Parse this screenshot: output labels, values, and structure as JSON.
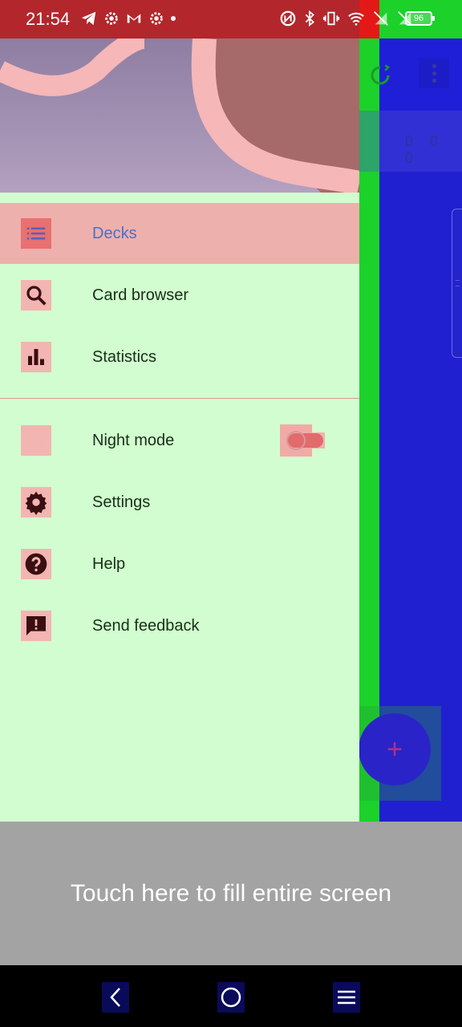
{
  "status_bar": {
    "time": "21:54",
    "battery_level": "96",
    "left_icons": [
      "telegram-icon",
      "settings-icon",
      "gmail-icon",
      "settings-icon",
      "dot-icon"
    ],
    "right_icons": [
      "nfc-icon",
      "bluetooth-icon",
      "vibrate-icon",
      "wifi-icon",
      "no-sim-icon",
      "no-sim-icon"
    ]
  },
  "drawer": {
    "items": [
      {
        "label": "Decks",
        "icon": "list-icon",
        "active": true
      },
      {
        "label": "Card browser",
        "icon": "search-icon",
        "active": false
      },
      {
        "label": "Statistics",
        "icon": "bar-chart-icon",
        "active": false
      },
      {
        "label": "Night mode",
        "icon": "moon-icon",
        "toggle": false
      },
      {
        "label": "Settings",
        "icon": "gear-icon"
      },
      {
        "label": "Help",
        "icon": "help-icon"
      },
      {
        "label": "Send feedback",
        "icon": "feedback-icon"
      }
    ]
  },
  "background_app": {
    "counts": "0 0 0"
  },
  "fill_screen": {
    "label": "Touch here to fill entire screen"
  },
  "system_nav": [
    "back-icon",
    "home-icon",
    "recents-icon"
  ],
  "colors": {
    "drawer_bg": "#d2fdd0",
    "active_item_bg": "#eeb0ac",
    "active_label": "#4a70c8",
    "status_bar": "#b3262c",
    "app_bg": "#2020d0"
  }
}
